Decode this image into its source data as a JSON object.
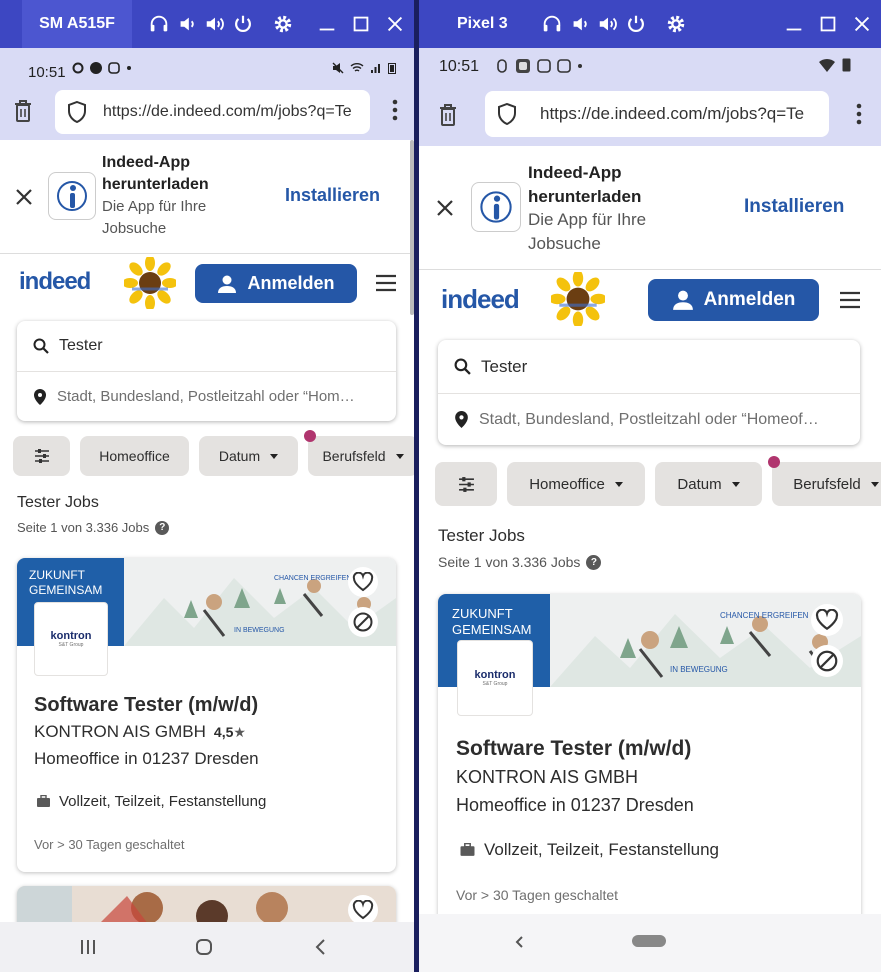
{
  "left": {
    "device_name": "SM A515F",
    "status": {
      "time": "10:51"
    },
    "url": "https://de.indeed.com/m/jobs?q=Te",
    "banner": {
      "title_line1": "Indeed-App",
      "title_line2": "herunterladen",
      "sub_line1": "Die App für Ihre",
      "sub_line2": "Jobsuche",
      "install_label": "Installieren"
    },
    "logo": "indeed",
    "login_label": "Anmelden",
    "search": {
      "what_value": "Tester",
      "where_placeholder": "Stadt, Bundesland, Postleitzahl oder “Hom…"
    },
    "chips": {
      "homeoffice": "Homeoffice",
      "datum": "Datum",
      "berufsfeld": "Berufsfeld"
    },
    "jobs_title": "Tester Jobs",
    "jobs_sub": "Seite 1 von 3.336 Jobs",
    "job": {
      "promo_line1": "ZUKUNFT",
      "promo_line2": "GEMEINSAM",
      "company_logo": "kontron",
      "company_logo_sub": "S&T Group",
      "title": "Software Tester (m/w/d)",
      "company": "KONTRON AIS GMBH",
      "rating": "4,5",
      "location": "Homeoffice in 01237 Dresden",
      "type": "Vollzeit, Teilzeit, Festanstellung",
      "posted": "Vor > 30 Tagen geschaltet"
    }
  },
  "right": {
    "device_name": "Pixel 3",
    "status": {
      "time": "10:51"
    },
    "url": "https://de.indeed.com/m/jobs?q=Te",
    "banner": {
      "title_line1": "Indeed-App",
      "title_line2": "herunterladen",
      "sub_line1": "Die App für Ihre",
      "sub_line2": "Jobsuche",
      "install_label": "Installieren"
    },
    "logo": "indeed",
    "login_label": "Anmelden",
    "search": {
      "what_value": "Tester",
      "where_placeholder": "Stadt, Bundesland, Postleitzahl oder “Homeof…"
    },
    "chips": {
      "homeoffice": "Homeoffice",
      "datum": "Datum",
      "berufsfeld": "Berufsfeld"
    },
    "jobs_title": "Tester Jobs",
    "jobs_sub": "Seite 1 von 3.336 Jobs",
    "job": {
      "promo_line1": "ZUKUNFT",
      "promo_line2": "GEMEINSAM",
      "company_logo": "kontron",
      "company_logo_sub": "S&T Group",
      "title": "Software Tester (m/w/d)",
      "company": "KONTRON AIS GMBH",
      "location": "Homeoffice in 01237 Dresden",
      "type": "Vollzeit, Teilzeit, Festanstellung",
      "posted": "Vor > 30 Tagen geschaltet"
    }
  },
  "colors": {
    "titlebar": "#3d47c2",
    "accent": "#2557a7",
    "dot": "#b0356e"
  }
}
